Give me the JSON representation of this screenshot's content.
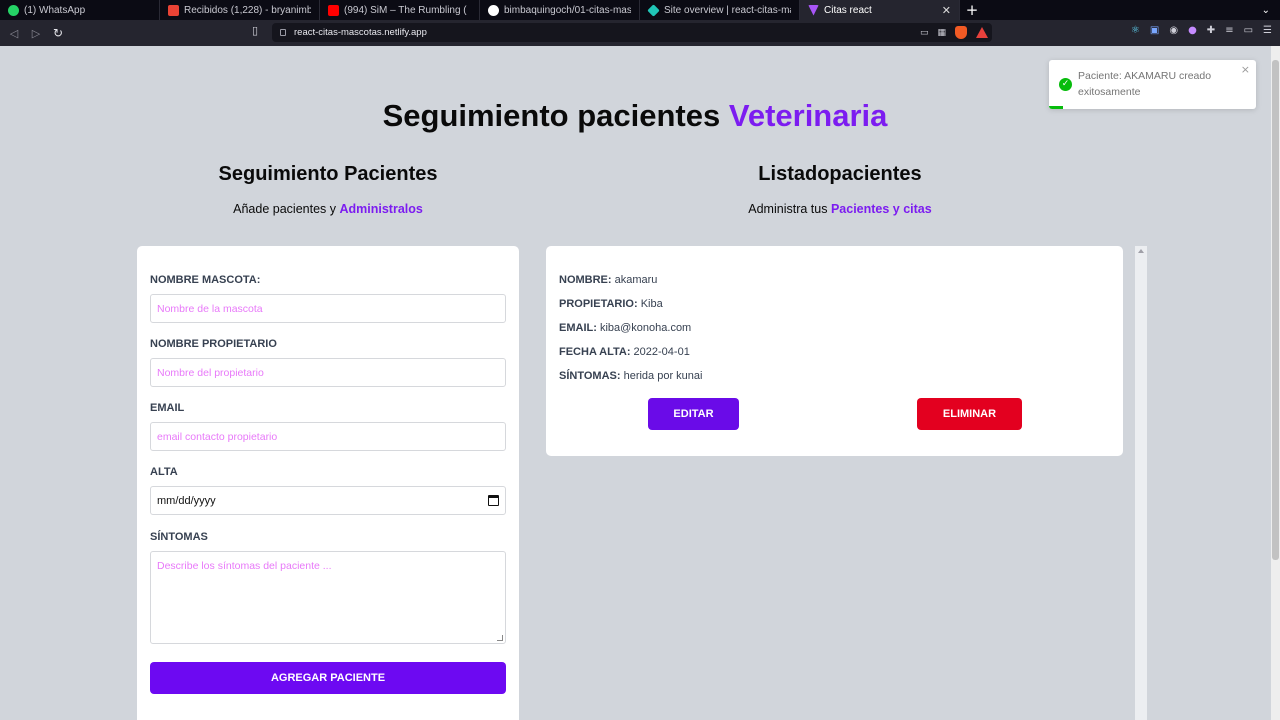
{
  "browser": {
    "tabs": [
      {
        "title": "(1) WhatsApp",
        "fav_color": "#25d366"
      },
      {
        "title": "Recibidos (1,228) - bryanimba",
        "fav_color": "#ea4335"
      },
      {
        "title": "(994) SiM – The Rumbling (",
        "fav_color": "#ff0000"
      },
      {
        "title": "bimbaquingoch/01-citas-masc",
        "fav_color": "#ffffff"
      },
      {
        "title": "Site overview | react-citas-ma",
        "fav_color": "#20c6b7"
      },
      {
        "title": "Citas react",
        "fav_color": "#a855f7"
      }
    ],
    "url": "react-citas-mascotas.netlify.app"
  },
  "page": {
    "title_main": "Seguimiento pacientes",
    "title_accent": "Veterinaria",
    "left_heading": "Seguimiento Pacientes",
    "left_sub_text": "Añade pacientes y",
    "left_sub_accent": "Administralos",
    "right_heading": "Listadopacientes",
    "right_sub_text": "Administra tus",
    "right_sub_accent": "Pacientes y citas"
  },
  "form": {
    "pet_label": "NOMBRE MASCOTA:",
    "pet_placeholder": "Nombre de la mascota",
    "owner_label": "NOMBRE PROPIETARIO",
    "owner_placeholder": "Nombre del propietario",
    "email_label": "EMAIL",
    "email_placeholder": "email contacto propietario",
    "date_label": "ALTA",
    "date_value": "mm/dd/yyyy",
    "symptoms_label": "SÍNTOMAS",
    "symptoms_placeholder": "Describe los síntomas del paciente ...",
    "submit_label": "AGREGAR PACIENTE"
  },
  "patient": {
    "name_label": "NOMBRE:",
    "name": "akamaru",
    "owner_label": "PROPIETARIO:",
    "owner": "Kiba",
    "email_label": "EMAIL:",
    "email": "kiba@konoha.com",
    "date_label": "FECHA ALTA:",
    "date": "2022-04-01",
    "symptoms_label": "SÍNTOMAS:",
    "symptoms": "herida por kunai",
    "edit_label": "EDITAR",
    "delete_label": "ELIMINAR"
  },
  "toast": {
    "message": "Paciente: AKAMARU creado exitosamente",
    "close": "×",
    "progress": 0.07
  },
  "colors": {
    "accent": "#7c1cf0",
    "primary_button": "#6d09f2",
    "danger_button": "#e3001f",
    "success": "#07bc0c"
  }
}
